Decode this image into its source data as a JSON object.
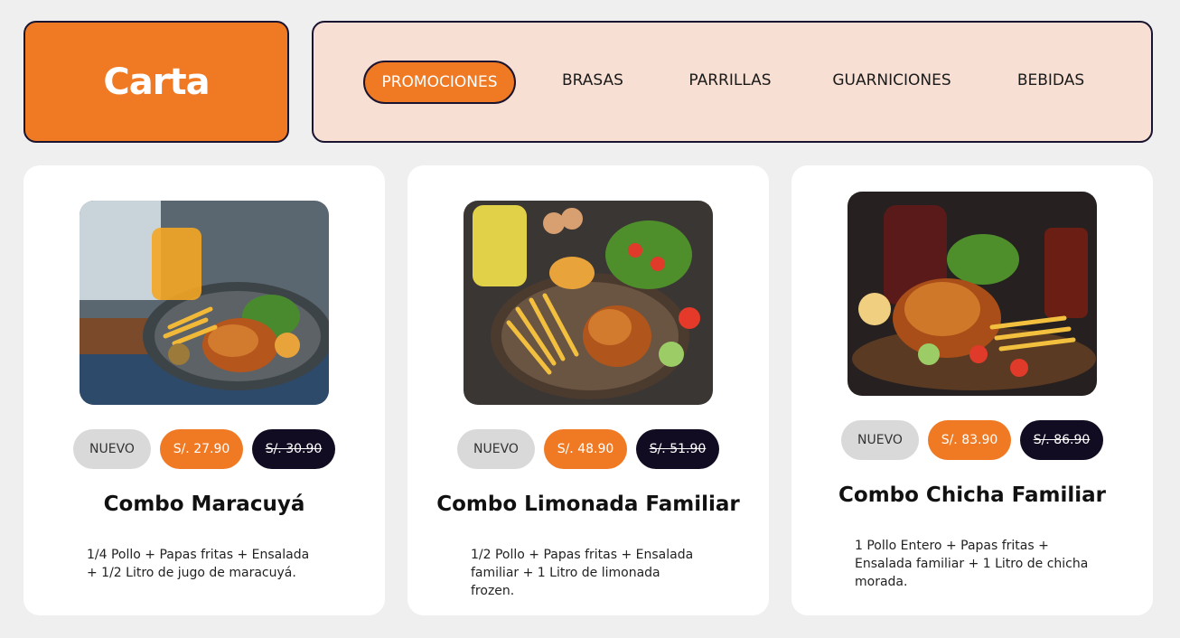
{
  "header": {
    "title": "Carta"
  },
  "nav": {
    "items": [
      {
        "label": "PROMOCIONES",
        "active": true
      },
      {
        "label": "BRASAS",
        "active": false
      },
      {
        "label": "PARRILLAS",
        "active": false
      },
      {
        "label": "GUARNICIONES",
        "active": false
      },
      {
        "label": "BEBIDAS",
        "active": false
      }
    ]
  },
  "colors": {
    "accent": "#f07a24",
    "dark": "#120c22",
    "nav_background": "#f7dfd3",
    "page_background": "#efefef"
  },
  "products": [
    {
      "badge": "NUEVO",
      "price": "S/. 27.90",
      "old_price": "S/. 30.90",
      "name": "Combo Maracuyá",
      "description": "1/4 Pollo + Papas fritas + Ensalada + 1/2 Litro de jugo de maracuyá.",
      "image_icon": "chicken-combo-photo-icon"
    },
    {
      "badge": "NUEVO",
      "price": "S/. 48.90",
      "old_price": "S/. 51.90",
      "name": "Combo Limonada Familiar",
      "description": "1/2 Pollo + Papas fritas + Ensalada familiar + 1 Litro de limonada frozen.",
      "image_icon": "chicken-combo-photo-icon"
    },
    {
      "badge": "NUEVO",
      "price": "S/. 83.90",
      "old_price": "S/. 86.90",
      "name": "Combo Chicha Familiar",
      "description": "1 Pollo Entero + Papas fritas + Ensalada familiar + 1 Litro de chicha morada.",
      "image_icon": "chicken-combo-photo-icon"
    }
  ]
}
